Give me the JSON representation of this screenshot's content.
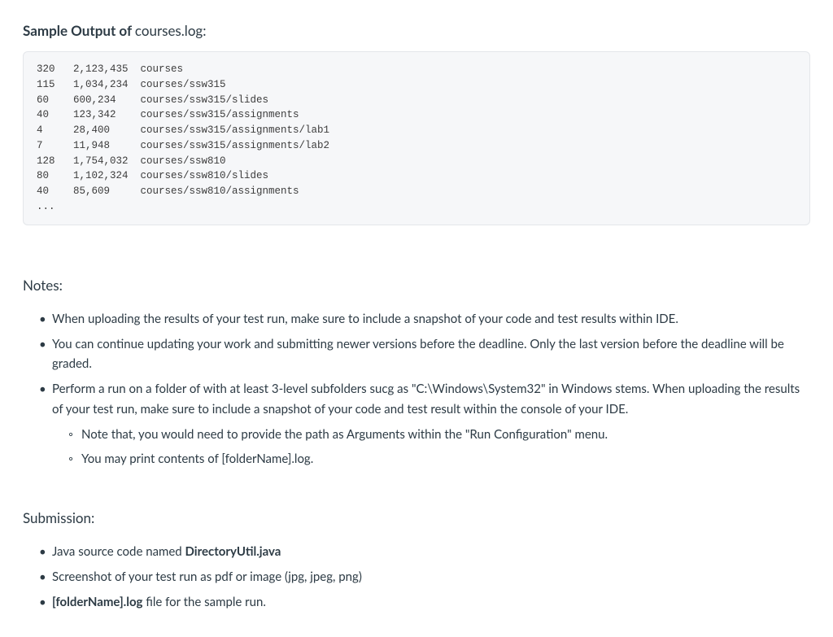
{
  "headings": {
    "sample_output_bold": "Sample Output of ",
    "sample_output_normal": "courses.log:",
    "notes": "Notes:",
    "submission": "Submission:"
  },
  "code_output": "320   2,123,435  courses\n115   1,034,234  courses/ssw315\n60    600,234    courses/ssw315/slides\n40    123,342    courses/ssw315/assignments\n4     28,400     courses/ssw315/assignments/lab1\n7     11,948     courses/ssw315/assignments/lab2\n128   1,754,032  courses/ssw810\n80    1,102,324  courses/ssw810/slides\n40    85,609     courses/ssw810/assignments\n...",
  "notes_items": {
    "item1": "When uploading the results of your test run, make sure to include a snapshot of your code and test results within IDE.",
    "item2": "You can continue updating your work and submitting newer versions before the deadline. Only the last version before the deadline will be graded.",
    "item3": "Perform a run on a folder of with at least 3-level subfolders sucg as \"C:\\Windows\\System32\" in Windows stems. When uploading the results of your test run, make sure to include a snapshot of your code and test result within the console of your IDE.",
    "item3_sub1": "Note that, you would need to provide the path as Arguments within the \"Run Configuration\" menu.",
    "item3_sub2": "You may print contents of [folderName].log."
  },
  "submission_items": {
    "item1_prefix": "Java source code named ",
    "item1_bold": "DirectoryUtil.java",
    "item2": "Screenshot of your test run as pdf or image (jpg, jpeg, png)",
    "item3_bold": "[folderName].log",
    "item3_suffix": " file for the sample run."
  }
}
